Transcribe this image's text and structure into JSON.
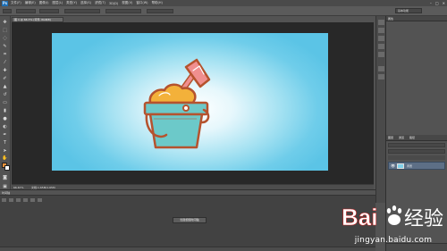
{
  "menubar": {
    "logo": "Ps",
    "items": [
      "文件(F)",
      "编辑(E)",
      "图像(I)",
      "图层(L)",
      "类型(Y)",
      "选择(S)",
      "滤镜(T)",
      "3D(D)",
      "视图(V)",
      "窗口(W)",
      "帮助(H)"
    ],
    "window_controls": [
      "–",
      "□",
      "✕"
    ]
  },
  "options_bar": {
    "workspace": "基本功能"
  },
  "document": {
    "tab_title": "图 1 @ 66.7% (背景, RGB/8)",
    "zoom": "66.67%",
    "doc_info": "文档:1.65M/1.65M"
  },
  "timeline": {
    "tab": "时间轴",
    "create_button": "创建视频时间轴"
  },
  "panels": {
    "properties_title": "属性",
    "layers_tabs": [
      "图层",
      "通道",
      "路径"
    ],
    "layer_name": "背景"
  },
  "watermark": {
    "logo_text": "Bai du 经验",
    "url": "jingyan.baidu.com"
  },
  "colors": {
    "foreground": "#e8913a",
    "background": "#ffffff",
    "bucket_teal": "#6cc9c9",
    "bucket_outline": "#b5532e",
    "sand": "#f3b13a",
    "shovel": "#f08f8f"
  }
}
